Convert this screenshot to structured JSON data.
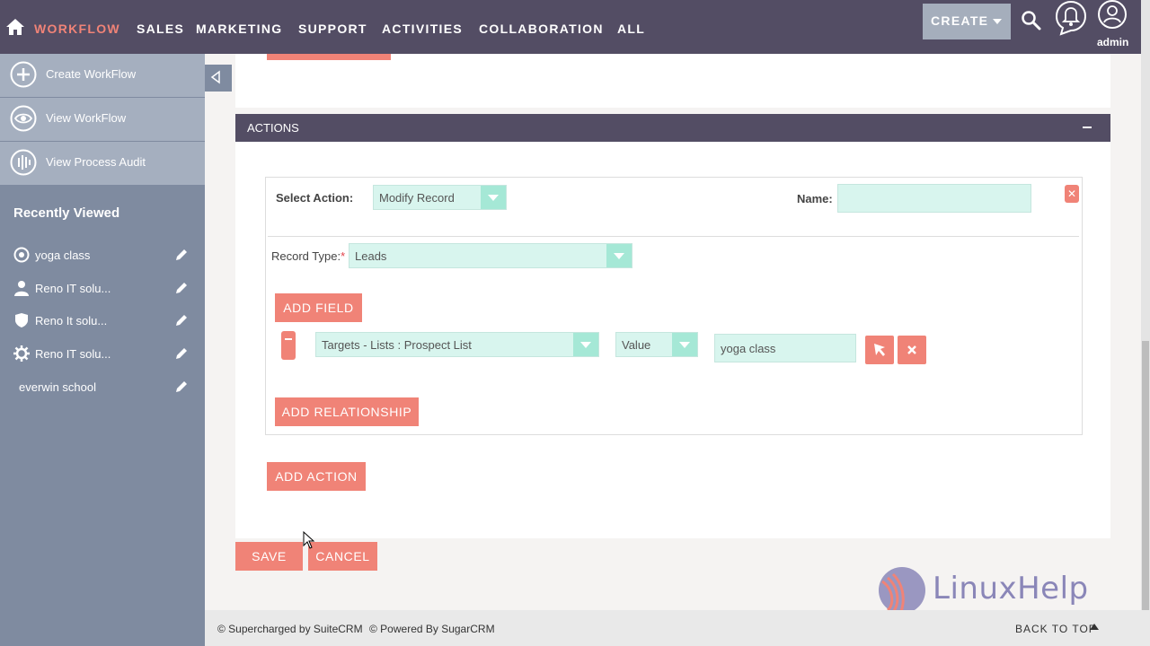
{
  "nav": {
    "items": [
      "WORKFLOW",
      "SALES",
      "MARKETING",
      "SUPPORT",
      "ACTIVITIES",
      "COLLABORATION",
      "ALL"
    ],
    "create_label": "CREATE",
    "user_label": "admin",
    "active_color": "#f08377"
  },
  "sidebar": {
    "actions": [
      "Create WorkFlow",
      "View WorkFlow",
      "View Process Audit"
    ],
    "recent_title": "Recently Viewed",
    "recent_items": [
      "yoga class",
      "Reno IT solu...",
      "Reno It solu...",
      "Reno IT solu...",
      "everwin school"
    ]
  },
  "actions_panel": {
    "title": "ACTIONS",
    "select_action_label": "Select Action:",
    "select_action_value": "Modify Record",
    "name_label": "Name:",
    "name_value": "",
    "record_type_label": "Record Type:",
    "required_mark": "*",
    "record_type_value": "Leads",
    "add_field_label": "ADD FIELD",
    "field_select_value": "Targets - Lists : Prospect List",
    "field_type_value": "Value",
    "field_value": "yoga class",
    "remove_symbol": "✕",
    "add_relationship_label": "ADD RELATIONSHIP",
    "add_action_label": "ADD ACTION"
  },
  "form_buttons": {
    "save": "SAVE",
    "cancel": "CANCEL"
  },
  "footer": {
    "supercharged": "© Supercharged by SuiteCRM",
    "powered": "© Powered By SugarCRM",
    "back_to_top": "BACK TO TOP"
  },
  "watermark": {
    "text": "LinuxHelp"
  },
  "colors": {
    "nav_bg": "#534d64",
    "accent": "#f08377",
    "sidebar_bg": "#7f8ba0",
    "teal": "#a5e8d6"
  }
}
